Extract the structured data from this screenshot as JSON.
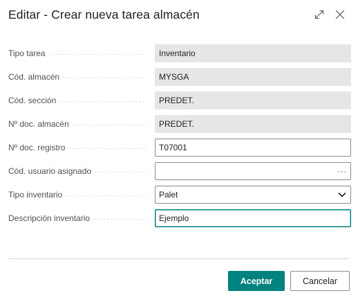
{
  "dialog": {
    "title": "Editar - Crear nueva tarea almacén",
    "expand_icon": "expand-icon",
    "close_icon": "close-icon"
  },
  "fields": [
    {
      "label": "Tipo tarea",
      "value": "Inventario",
      "kind": "readonly"
    },
    {
      "label": "Cód. almacén",
      "value": "MYSGA",
      "kind": "readonly"
    },
    {
      "label": "Cód. sección",
      "value": "PREDET.",
      "kind": "readonly"
    },
    {
      "label": "Nº doc. almacén",
      "value": "PREDET.",
      "kind": "readonly"
    },
    {
      "label": "Nº doc. registro",
      "value": "T07001",
      "kind": "text"
    },
    {
      "label": "Cód. usuario asignado",
      "value": "",
      "kind": "lookup",
      "lookup_glyph": "···"
    },
    {
      "label": "Tipo inventario",
      "value": "Palet",
      "kind": "select",
      "icon": "chevron-down-icon"
    },
    {
      "label": "Descripción inventario",
      "value": "Ejemplo",
      "kind": "text-focused"
    }
  ],
  "footer": {
    "ok_label": "Aceptar",
    "cancel_label": "Cancelar"
  },
  "colors": {
    "accent": "#00827f",
    "readonly_bg": "#e6e6e7"
  }
}
